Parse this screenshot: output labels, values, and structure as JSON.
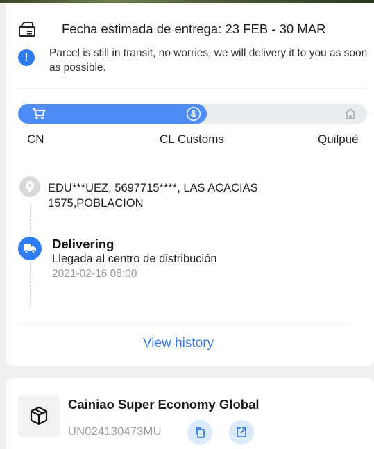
{
  "estimate": {
    "icon": "truck-box-icon",
    "text": "Fecha estimada de entrega: 23 FEB - 30 MAR"
  },
  "notice": {
    "icon": "info-icon",
    "symbol": "!",
    "text": "Parcel is still in transit, no worries, we will delivery it to you as soon as possible."
  },
  "progress": {
    "fraction": 0.54,
    "fill_color": "#4e8df5",
    "track_color": "#e8ebf0",
    "origin": "CN",
    "midpoint": "CL Customs",
    "destination": "Quilpué",
    "icons": [
      "cart-icon",
      "anchor-icon",
      "home-icon"
    ]
  },
  "timeline": {
    "address": "EDU***UEZ,  5697715****,  LAS ACACIAS 1575,POBLACION",
    "latest_event": {
      "status": "Delivering",
      "description": "Llegada al centro de distribución",
      "timestamp": "2021-02-16 08:00"
    },
    "view_history_label": "View history"
  },
  "carrier": {
    "name": "Cainiao Super Economy Global",
    "tracking_number": "UN024130473MU",
    "actions": [
      "copy-icon",
      "external-link-icon"
    ]
  },
  "colors": {
    "accent": "#2f7cf3",
    "link": "#3a7be0"
  }
}
